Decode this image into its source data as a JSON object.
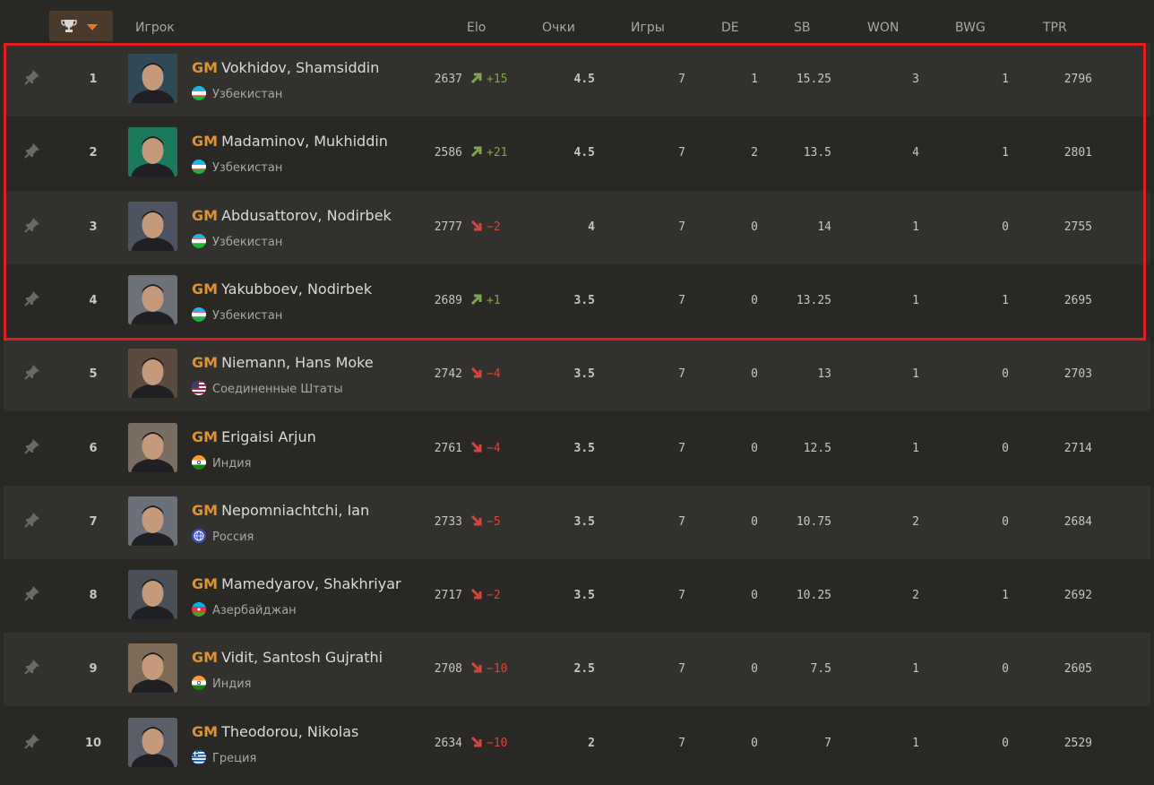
{
  "header": {
    "player_label": "Игрок",
    "elo": "Elo",
    "points": "Очки",
    "games": "Игры",
    "de": "DE",
    "sb": "SB",
    "won": "WON",
    "bwg": "BWG",
    "tpr": "TPR",
    "sort_icon": "trophy-icon"
  },
  "colors": {
    "title": "#e0922f",
    "up": "#7fa84e",
    "down": "#d9443b",
    "highlight": "#e01e24"
  },
  "rows": [
    {
      "rank": "1",
      "title": "GM",
      "name": "Vokhidov, Shamsiddin",
      "federation": "Узбекистан",
      "flag": "uz",
      "elo": "2637",
      "delta": "+15",
      "dir": "up",
      "points": "4.5",
      "games": "7",
      "de": "1",
      "sb": "15.25",
      "won": "3",
      "bwg": "1",
      "tpr": "2796"
    },
    {
      "rank": "2",
      "title": "GM",
      "name": "Madaminov, Mukhiddin",
      "federation": "Узбекистан",
      "flag": "uz",
      "elo": "2586",
      "delta": "+21",
      "dir": "up",
      "points": "4.5",
      "games": "7",
      "de": "2",
      "sb": "13.5",
      "won": "4",
      "bwg": "1",
      "tpr": "2801"
    },
    {
      "rank": "3",
      "title": "GM",
      "name": "Abdusattorov, Nodirbek",
      "federation": "Узбекистан",
      "flag": "uz",
      "elo": "2777",
      "delta": "−2",
      "dir": "down",
      "points": "4",
      "games": "7",
      "de": "0",
      "sb": "14",
      "won": "1",
      "bwg": "0",
      "tpr": "2755"
    },
    {
      "rank": "4",
      "title": "GM",
      "name": "Yakubboev, Nodirbek",
      "federation": "Узбекистан",
      "flag": "uz",
      "elo": "2689",
      "delta": "+1",
      "dir": "up",
      "points": "3.5",
      "games": "7",
      "de": "0",
      "sb": "13.25",
      "won": "1",
      "bwg": "1",
      "tpr": "2695"
    },
    {
      "rank": "5",
      "title": "GM",
      "name": "Niemann, Hans Moke",
      "federation": "Соединенные Штаты",
      "flag": "us",
      "elo": "2742",
      "delta": "−4",
      "dir": "down",
      "points": "3.5",
      "games": "7",
      "de": "0",
      "sb": "13",
      "won": "1",
      "bwg": "0",
      "tpr": "2703"
    },
    {
      "rank": "6",
      "title": "GM",
      "name": "Erigaisi Arjun",
      "federation": "Индия",
      "flag": "in",
      "elo": "2761",
      "delta": "−4",
      "dir": "down",
      "points": "3.5",
      "games": "7",
      "de": "0",
      "sb": "12.5",
      "won": "1",
      "bwg": "0",
      "tpr": "2714"
    },
    {
      "rank": "7",
      "title": "GM",
      "name": "Nepomniachtchi, Ian",
      "federation": "Россия",
      "flag": "fide",
      "elo": "2733",
      "delta": "−5",
      "dir": "down",
      "points": "3.5",
      "games": "7",
      "de": "0",
      "sb": "10.75",
      "won": "2",
      "bwg": "0",
      "tpr": "2684"
    },
    {
      "rank": "8",
      "title": "GM",
      "name": "Mamedyarov, Shakhriyar",
      "federation": "Азербайджан",
      "flag": "az",
      "elo": "2717",
      "delta": "−2",
      "dir": "down",
      "points": "3.5",
      "games": "7",
      "de": "0",
      "sb": "10.25",
      "won": "2",
      "bwg": "1",
      "tpr": "2692"
    },
    {
      "rank": "9",
      "title": "GM",
      "name": "Vidit, Santosh Gujrathi",
      "federation": "Индия",
      "flag": "in",
      "elo": "2708",
      "delta": "−10",
      "dir": "down",
      "points": "2.5",
      "games": "7",
      "de": "0",
      "sb": "7.5",
      "won": "1",
      "bwg": "0",
      "tpr": "2605"
    },
    {
      "rank": "10",
      "title": "GM",
      "name": "Theodorou, Nikolas",
      "federation": "Греция",
      "flag": "gr",
      "elo": "2634",
      "delta": "−10",
      "dir": "down",
      "points": "2",
      "games": "7",
      "de": "0",
      "sb": "7",
      "won": "1",
      "bwg": "0",
      "tpr": "2529"
    }
  ]
}
